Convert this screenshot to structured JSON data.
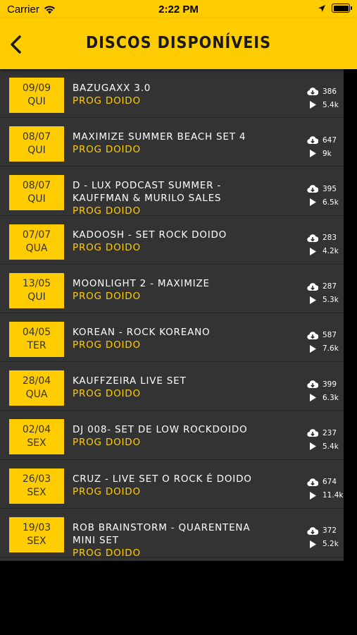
{
  "status": {
    "carrier": "Carrier",
    "time": "2:22 PM"
  },
  "header": {
    "title": "DISCOS DISPONÍVEIS"
  },
  "colors": {
    "accent": "#ffcc00",
    "background": "#333333"
  },
  "discs": [
    {
      "date": "09/09",
      "day": "QUI",
      "name": "BAZUGAXX 3.0",
      "genre": "PROG DOIDO",
      "downloads": "386",
      "plays": "5.4k"
    },
    {
      "date": "08/07",
      "day": "QUI",
      "name": "MAXIMIZE SUMMER BEACH SET 4",
      "genre": "PROG DOIDO",
      "downloads": "647",
      "plays": "9k"
    },
    {
      "date": "08/07",
      "day": "QUI",
      "name": "D - LUX PODCAST SUMMER - KAUFFMAN & MURILO SALES",
      "genre": "PROG DOIDO",
      "downloads": "395",
      "plays": "6.5k"
    },
    {
      "date": "07/07",
      "day": "QUA",
      "name": "KADOOSH - SET ROCK DOIDO",
      "genre": "PROG DOIDO",
      "downloads": "283",
      "plays": "4.2k"
    },
    {
      "date": "13/05",
      "day": "QUI",
      "name": "MOONLIGHT 2 - MAXIMIZE",
      "genre": "PROG DOIDO",
      "downloads": "287",
      "plays": "5.3k"
    },
    {
      "date": "04/05",
      "day": "TER",
      "name": "KOREAN - ROCK KOREANO",
      "genre": "PROG DOIDO",
      "downloads": "587",
      "plays": "7.6k"
    },
    {
      "date": "28/04",
      "day": "QUA",
      "name": "KAUFFZEIRA LIVE SET",
      "genre": "PROG DOIDO",
      "downloads": "399",
      "plays": "6.3k"
    },
    {
      "date": "02/04",
      "day": "SEX",
      "name": "DJ 008- SET DE LOW ROCKDOIDO",
      "genre": "PROG DOIDO",
      "downloads": "237",
      "plays": "5.4k"
    },
    {
      "date": "26/03",
      "day": "SEX",
      "name": "CRUZ - LIVE SET O ROCK É DOIDO",
      "genre": "PROG DOIDO",
      "downloads": "674",
      "plays": "11.4k"
    },
    {
      "date": "19/03",
      "day": "SEX",
      "name": "ROB BRAINSTORM - QUARENTENA MINI SET",
      "genre": "PROG DOIDO",
      "downloads": "372",
      "plays": "5.2k"
    }
  ]
}
